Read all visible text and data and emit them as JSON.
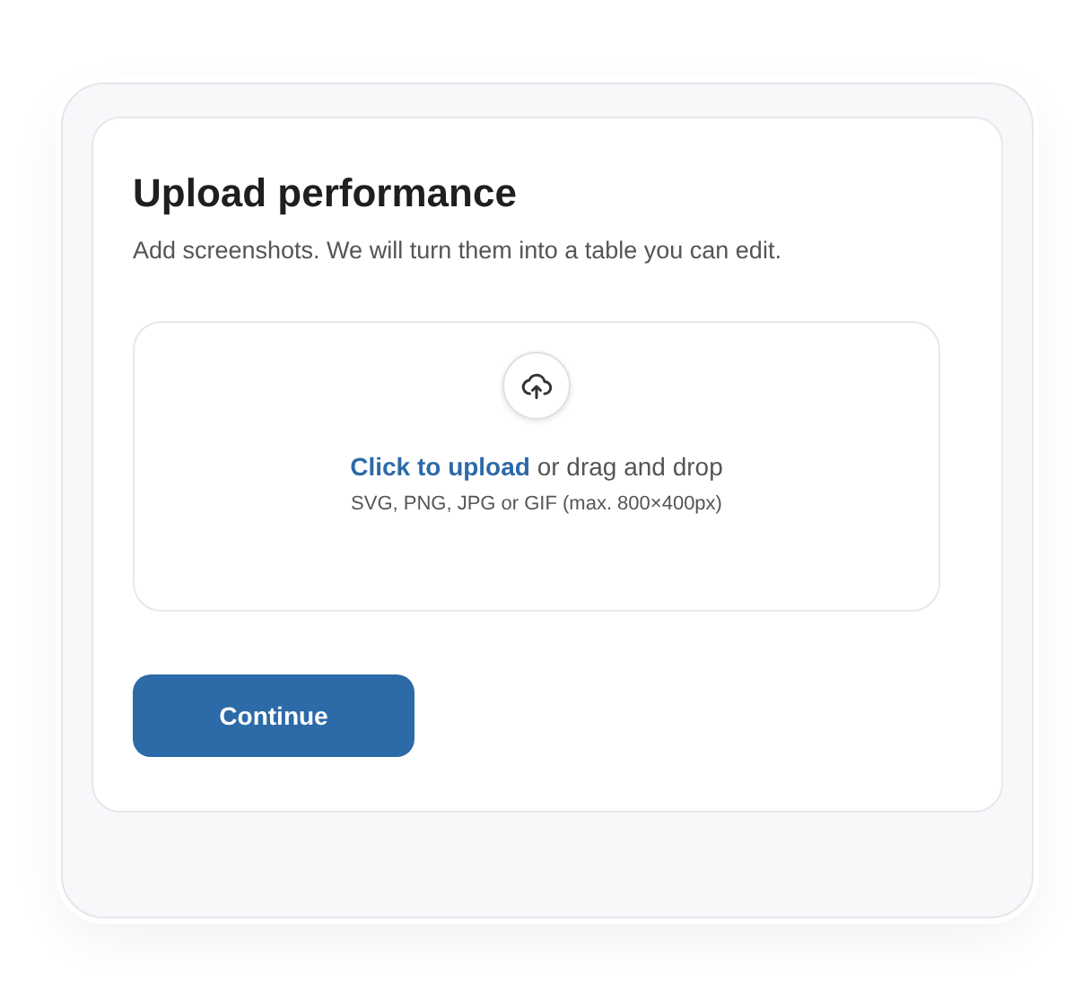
{
  "title": "Upload performance",
  "subtitle": "Add screenshots. We will turn them into a table you can edit.",
  "dropzone": {
    "link": "Click to upload",
    "prompt": "or drag and drop",
    "hint": "SVG, PNG, JPG or GIF (max. 800×400px)"
  },
  "buttons": [
    "Continue"
  ]
}
